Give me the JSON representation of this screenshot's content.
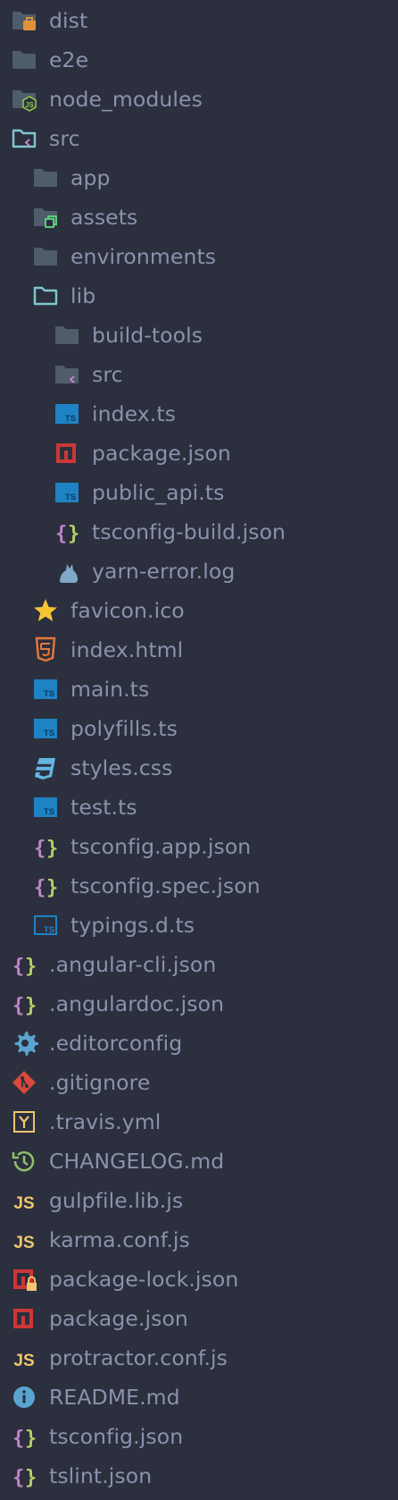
{
  "colors": {
    "background": "#2b2f3e",
    "text": "#8b92ad",
    "folder": "#4f5c6b",
    "folder_open_outline": "#7fc8cf",
    "ts_blue": "#1f82c4",
    "npm_red": "#cb3837",
    "json_purple": "#c385c8",
    "json_green": "#b5cf6b",
    "js_yellow": "#f0c66d"
  },
  "tree": [
    {
      "label": "dist",
      "icon": "folder-dist-icon",
      "depth": 0
    },
    {
      "label": "e2e",
      "icon": "folder-icon",
      "depth": 0
    },
    {
      "label": "node_modules",
      "icon": "folder-node-icon",
      "depth": 0
    },
    {
      "label": "src",
      "icon": "folder-src-open-icon",
      "depth": 0
    },
    {
      "label": "app",
      "icon": "folder-icon",
      "depth": 1
    },
    {
      "label": "assets",
      "icon": "folder-assets-icon",
      "depth": 1
    },
    {
      "label": "environments",
      "icon": "folder-icon",
      "depth": 1
    },
    {
      "label": "lib",
      "icon": "folder-open-icon",
      "depth": 1
    },
    {
      "label": "build-tools",
      "icon": "folder-icon",
      "depth": 2
    },
    {
      "label": "src",
      "icon": "folder-src-icon",
      "depth": 2
    },
    {
      "label": "index.ts",
      "icon": "typescript-icon",
      "depth": 2
    },
    {
      "label": "package.json",
      "icon": "npm-icon",
      "depth": 2
    },
    {
      "label": "public_api.ts",
      "icon": "typescript-icon",
      "depth": 2
    },
    {
      "label": "tsconfig-build.json",
      "icon": "json-icon",
      "depth": 2
    },
    {
      "label": "yarn-error.log",
      "icon": "yarn-cat-icon",
      "depth": 2
    },
    {
      "label": "favicon.ico",
      "icon": "star-icon",
      "depth": 1
    },
    {
      "label": "index.html",
      "icon": "html5-icon",
      "depth": 1
    },
    {
      "label": "main.ts",
      "icon": "typescript-icon",
      "depth": 1
    },
    {
      "label": "polyfills.ts",
      "icon": "typescript-icon",
      "depth": 1
    },
    {
      "label": "styles.css",
      "icon": "css3-icon",
      "depth": 1
    },
    {
      "label": "test.ts",
      "icon": "typescript-icon",
      "depth": 1
    },
    {
      "label": "tsconfig.app.json",
      "icon": "json-icon",
      "depth": 1
    },
    {
      "label": "tsconfig.spec.json",
      "icon": "json-icon",
      "depth": 1
    },
    {
      "label": "typings.d.ts",
      "icon": "typescript-def-icon",
      "depth": 1
    },
    {
      "label": ".angular-cli.json",
      "icon": "json-icon",
      "depth": 0
    },
    {
      "label": ".angulardoc.json",
      "icon": "json-icon",
      "depth": 0
    },
    {
      "label": ".editorconfig",
      "icon": "gear-icon",
      "depth": 0
    },
    {
      "label": ".gitignore",
      "icon": "git-icon",
      "depth": 0
    },
    {
      "label": ".travis.yml",
      "icon": "yaml-icon",
      "depth": 0
    },
    {
      "label": "CHANGELOG.md",
      "icon": "history-icon",
      "depth": 0
    },
    {
      "label": "gulpfile.lib.js",
      "icon": "javascript-icon",
      "depth": 0
    },
    {
      "label": "karma.conf.js",
      "icon": "javascript-icon",
      "depth": 0
    },
    {
      "label": "package-lock.json",
      "icon": "npm-lock-icon",
      "depth": 0
    },
    {
      "label": "package.json",
      "icon": "npm-icon",
      "depth": 0
    },
    {
      "label": "protractor.conf.js",
      "icon": "javascript-icon",
      "depth": 0
    },
    {
      "label": "README.md",
      "icon": "info-icon",
      "depth": 0
    },
    {
      "label": "tsconfig.json",
      "icon": "json-icon",
      "depth": 0
    },
    {
      "label": "tslint.json",
      "icon": "json-icon",
      "depth": 0
    }
  ]
}
